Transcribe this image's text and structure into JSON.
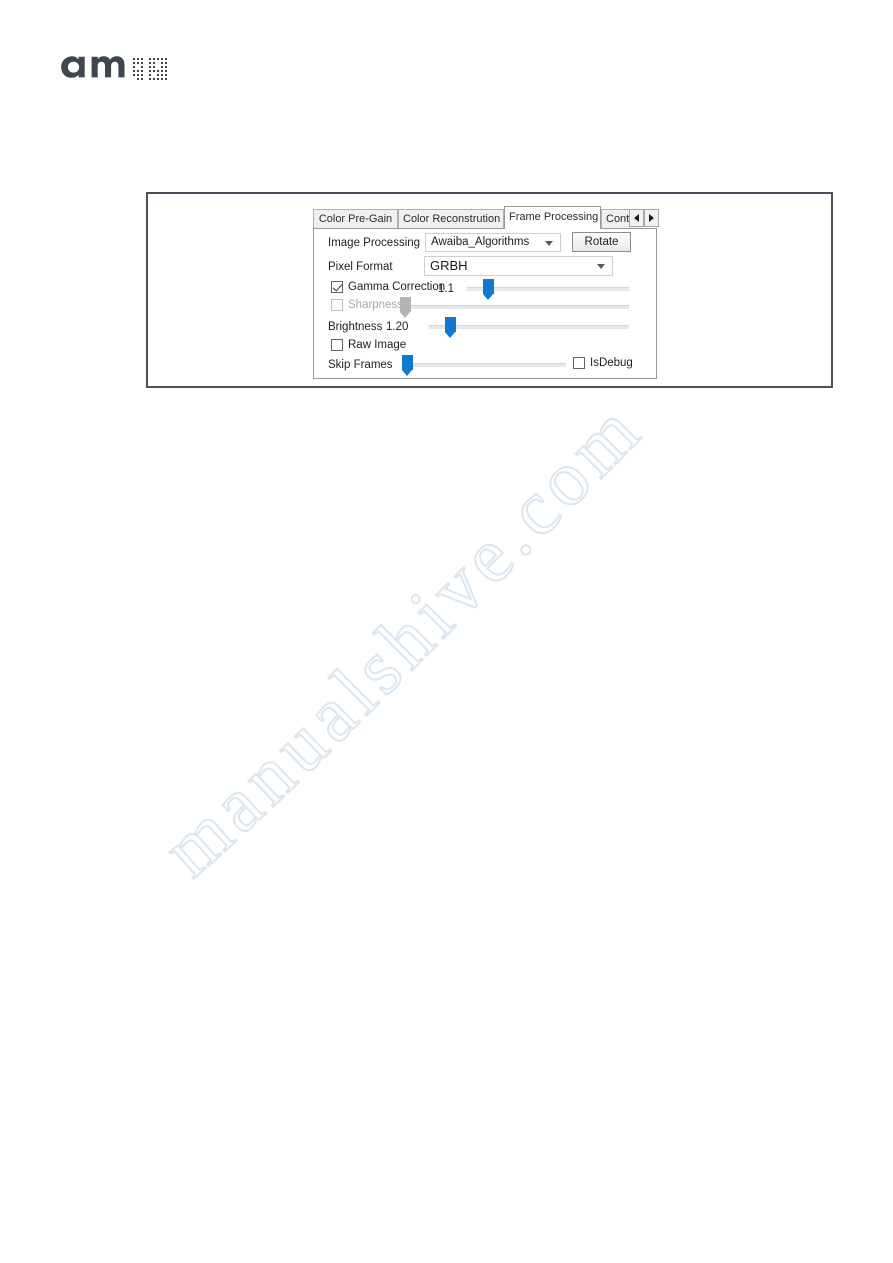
{
  "logo": {
    "brand": "ams",
    "alt": "ams-logo"
  },
  "figure": {
    "app_panel": {
      "tabs": [
        {
          "label": "Color Pre-Gain",
          "selected": false
        },
        {
          "label": "Color Reconstrution",
          "selected": false
        },
        {
          "label": "Frame Processing",
          "selected": true
        },
        {
          "label": "Contrast",
          "selected": false
        }
      ],
      "tab_scroll": {
        "left_icon": "triangle-left-icon",
        "right_icon": "triangle-right-icon"
      },
      "fields": {
        "image_processing_label": "Image Processing",
        "image_processing_value": "Awaiba_Algorithms",
        "rotate_button": "Rotate",
        "pixel_format_label": "Pixel Format",
        "pixel_format_value": "GRBH",
        "gamma_correction_label": "Gamma Correction",
        "gamma_correction_checked": true,
        "gamma_correction_value": "1.1",
        "sharpness_label": "Sharpness",
        "sharpness_checked": false,
        "sharpness_enabled": false,
        "brightness_label": "Brightness",
        "brightness_value": "1.20",
        "raw_image_label": "Raw Image",
        "raw_image_checked": false,
        "skip_frames_label": "Skip Frames",
        "is_debug_label": "IsDebug",
        "is_debug_checked": false
      },
      "colors": {
        "slider_accent": "#1277cd",
        "slider_disabled": "#b4b4b4",
        "panel_border": "#9a9a9a",
        "frame_border": "#4a4f5a"
      }
    }
  },
  "watermark": {
    "text": "manualshive.com"
  }
}
